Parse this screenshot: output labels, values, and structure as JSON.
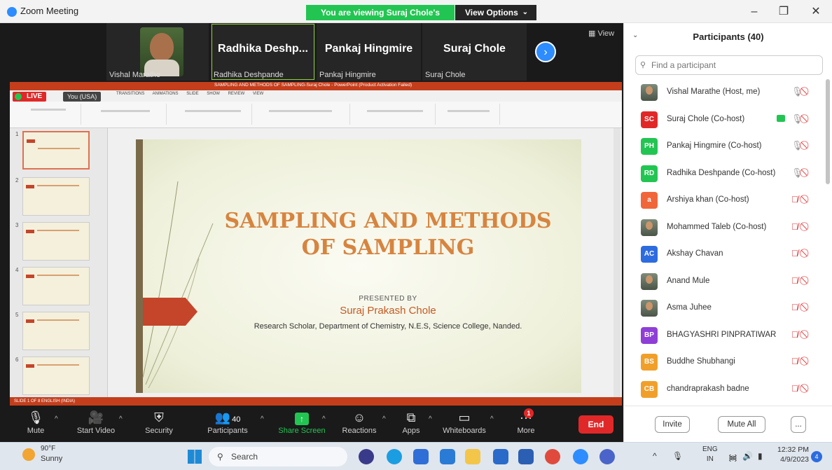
{
  "window": {
    "app_title": "Zoom Meeting",
    "viewing_banner": "You are viewing Suraj Chole's screen",
    "view_options": "View Options"
  },
  "video_strip": {
    "view_label": "View",
    "tiles": [
      {
        "name": "Vishal Marathe",
        "display": ""
      },
      {
        "name": "Radhika Deshpande",
        "display": "Radhika Deshp..."
      },
      {
        "name": "Pankaj Hingmire",
        "display": "Pankaj Hingmire"
      },
      {
        "name": "Suraj Chole",
        "display": "Suraj Chole"
      }
    ]
  },
  "shared_screen": {
    "live_label": "LIVE",
    "you_label": "You (USA)",
    "ppt_window_title": "SAMPLING AND METHODS OF SAMPLING-Suraj Chole - PowerPoint (Product Activation Failed)",
    "ribbon_tabs": "TRANSITIONS ANIMATIONS SLIDE SHOW REVIEW VIEW",
    "status_left": "SLIDE 1 OF 8 ENGLISH (INDIA)",
    "slide_numbers": [
      "1",
      "2",
      "3",
      "4",
      "5",
      "6"
    ],
    "slide": {
      "title": "SAMPLING AND METHODS OF SAMPLING",
      "presented_by": "PRESENTED BY",
      "presenter": "Suraj Prakash Chole",
      "affiliation": "Research Scholar, Department of Chemistry, N.E.S, Science College, Nanded."
    }
  },
  "toolbar": {
    "mute": "Mute",
    "start_video": "Start Video",
    "security": "Security",
    "participants": "Participants",
    "participant_count": "40",
    "share_screen": "Share Screen",
    "reactions": "Reactions",
    "apps": "Apps",
    "whiteboards": "Whiteboards",
    "more": "More",
    "more_badge": "1",
    "end": "End"
  },
  "participants_panel": {
    "title": "Participants (40)",
    "search_placeholder": "Find a participant",
    "participants": [
      {
        "name": "Vishal Marathe (Host, me)",
        "initials": "",
        "color": "",
        "mic_muted": false
      },
      {
        "name": "Suraj Chole (Co-host)",
        "initials": "SC",
        "color": "#e02828",
        "mic_muted": false,
        "sharing": true
      },
      {
        "name": "Pankaj Hingmire (Co-host)",
        "initials": "PH",
        "color": "#23c552",
        "mic_muted": false
      },
      {
        "name": "Radhika Deshpande (Co-host)",
        "initials": "RD",
        "color": "#23c552",
        "mic_muted": false
      },
      {
        "name": "Arshiya khan (Co-host)",
        "initials": "a",
        "color": "#f0663a",
        "mic_muted": true
      },
      {
        "name": "Mohammed Taleb (Co-host)",
        "initials": "",
        "color": "",
        "mic_muted": true
      },
      {
        "name": "Akshay Chavan",
        "initials": "AC",
        "color": "#2d6cdf",
        "mic_muted": true
      },
      {
        "name": "Anand Mule",
        "initials": "",
        "color": "",
        "mic_muted": true
      },
      {
        "name": "Asma Juhee",
        "initials": "",
        "color": "",
        "mic_muted": true
      },
      {
        "name": "BHAGYASHRI PINPRATIWAR",
        "initials": "BP",
        "color": "#8e3fd6",
        "mic_muted": true
      },
      {
        "name": "Buddhe Shubhangi",
        "initials": "BS",
        "color": "#f0a02a",
        "mic_muted": true
      },
      {
        "name": "chandraprakash badne",
        "initials": "CB",
        "color": "#f0a02a",
        "mic_muted": true
      }
    ],
    "invite": "Invite",
    "mute_all": "Mute All",
    "more": "..."
  },
  "taskbar": {
    "weather_temp": "90°F",
    "weather_cond": "Sunny",
    "search": "Search",
    "lang_top": "ENG",
    "lang_bottom": "IN",
    "time": "12:32 PM",
    "date": "4/9/2023",
    "notif_count": "4"
  }
}
